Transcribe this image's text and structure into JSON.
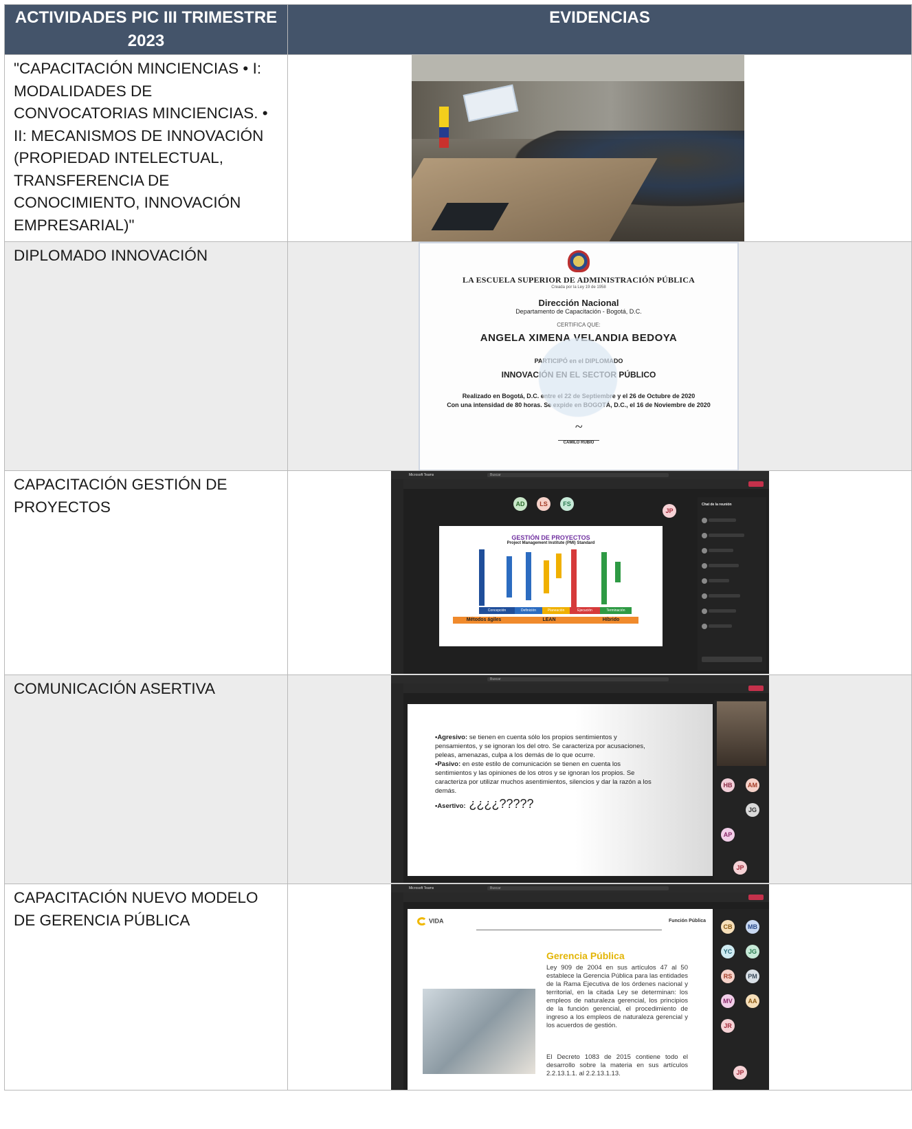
{
  "table": {
    "headers": [
      "ACTIVIDADES PIC III TRIMESTRE 2023",
      "EVIDENCIAS"
    ],
    "rows": [
      {
        "activity": "\"CAPACITACIÓN MINCIENCIAS • I: MODALIDADES DE CONVOCATORIAS MINCIENCIAS. • II: MECANISMOS DE INNOVACIÓN (PROPIEDAD INTELECTUAL, TRANSFERENCIA DE CONOCIMIENTO, INNOVACIÓN EMPRESARIAL)\""
      },
      {
        "activity": "DIPLOMADO INNOVACIÓN"
      },
      {
        "activity": "CAPACITACIÓN GESTIÓN DE PROYECTOS"
      },
      {
        "activity": "COMUNICACIÓN ASERTIVA"
      },
      {
        "activity": "CAPACITACIÓN NUEVO MODELO DE GERENCIA PÚBLICA"
      }
    ]
  },
  "certificate": {
    "school": "LA ESCUELA SUPERIOR DE ADMINISTRACIÓN PÚBLICA",
    "school_sub": "Creada por la Ley 19 de 1958",
    "direction": "Dirección Nacional",
    "department": "Departamento de Capacitación - Bogotá, D.C.",
    "certifies": "CERTIFICA QUE:",
    "name": "ANGELA XIMENA VELANDIA BEDOYA",
    "participated": "PARTICIPÓ en el DIPLOMADO",
    "course": "INNOVACIÓN EN EL SECTOR PÚBLICO",
    "realized": "Realizado en Bogotá, D.C. entre el 22 de Septiembre y el 26 de Octubre de 2020",
    "intensity": "Con una intensidad de 80 horas. Se expide en BOGOTÁ, D.C., el 16 de Noviembre de 2020",
    "signer": "CAMILO RUBIO"
  },
  "teams": {
    "app": "Microsoft Teams",
    "search": "Buscar",
    "leave": "Salir"
  },
  "proyectos_slide": {
    "title": "GESTIÓN DE PROYECTOS",
    "subtitle": "Project Management Institute (PMI) Standard",
    "phases": [
      "Concepción",
      "Definición",
      "Planeación",
      "Ejecución",
      "Terminación"
    ],
    "methods": [
      "Métodos ágiles",
      "LEAN",
      "Híbrido"
    ],
    "participants": [
      "AD",
      "LS",
      "FS",
      "JP"
    ],
    "chat_title": "Chat de la reunión"
  },
  "asertiva_slide": {
    "agresivo_label": "•Agresivo:",
    "agresivo_text": " se tienen en cuenta sólo los propios sentimientos y pensamientos, y se ignoran los del otro. Se caracteriza por acusaciones, peleas, amenazas, culpa a los demás de lo que ocurre.",
    "pasivo_label": "•Pasivo:",
    "pasivo_text": " en este estilo de comunicación se tienen en cuenta los sentimientos y las opiniones de los otros y se ignoran los propios. Se caracteriza por utilizar muchos asentimientos, silencios y dar la razón a los demás.",
    "asertivo_label": "•Asertivo:",
    "asertivo_text": " ¿¿¿¿?????",
    "participants": [
      "HB",
      "AM",
      "JG",
      "AP",
      "JP"
    ]
  },
  "gerencia_slide": {
    "brand": "VIDA",
    "brand_right": "Función Pública",
    "title": "Gerencia Pública",
    "p1": "Ley 909 de 2004 en sus artículos 47 al 50 establece la Gerencia Pública para las entidades de la Rama Ejecutiva de los órdenes nacional y territorial, en la citada Ley se determinan: los empleos de naturaleza gerencial, los principios de la función gerencial, el procedimiento de ingreso a los empleos de naturaleza gerencial y los acuerdos de gestión.",
    "p2": "El Decreto 1083 de 2015 contiene todo el desarrollo sobre la materia en sus artículos 2.2.13.1.1. al 2.2.13.1.13.",
    "participants": [
      "CB",
      "MB",
      "YC",
      "JG",
      "RS",
      "PM",
      "MV",
      "AA",
      "JR",
      "JP"
    ]
  },
  "colors": {
    "header_bg": "#44546a",
    "row_shade": "#ececec",
    "teams_bg": "#1f1f1f",
    "leave": "#c4314b",
    "gerencia_title": "#e3b505",
    "proyectos_title": "#7030a0"
  }
}
